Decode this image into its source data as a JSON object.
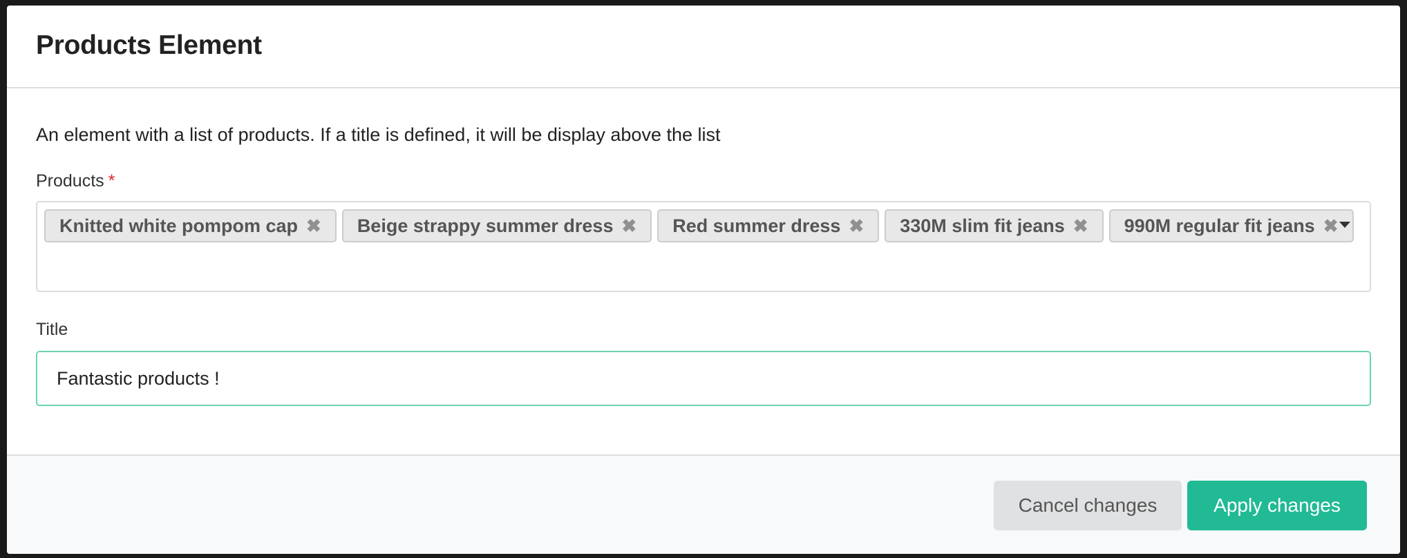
{
  "modal": {
    "title": "Products Element",
    "description": "An element with a list of products. If a title is defined, it will be display above the list"
  },
  "products_field": {
    "label": "Products",
    "required_marker": "*",
    "selected": [
      {
        "label": "Knitted white pompom cap",
        "remove_icon": "✖"
      },
      {
        "label": "Beige strappy summer dress",
        "remove_icon": "✖"
      },
      {
        "label": "Red summer dress",
        "remove_icon": "✖"
      },
      {
        "label": "330M slim fit jeans",
        "remove_icon": "✖"
      },
      {
        "label": "990M regular fit jeans",
        "remove_icon": "✖"
      }
    ],
    "dropdown_icon": "caret-down-icon"
  },
  "title_field": {
    "label": "Title",
    "value": "Fantastic products !"
  },
  "footer": {
    "cancel_label": "Cancel changes",
    "apply_label": "Apply changes"
  },
  "colors": {
    "accent": "#21ba95",
    "required": "#db2828",
    "focus_border": "#6dd3b4"
  }
}
